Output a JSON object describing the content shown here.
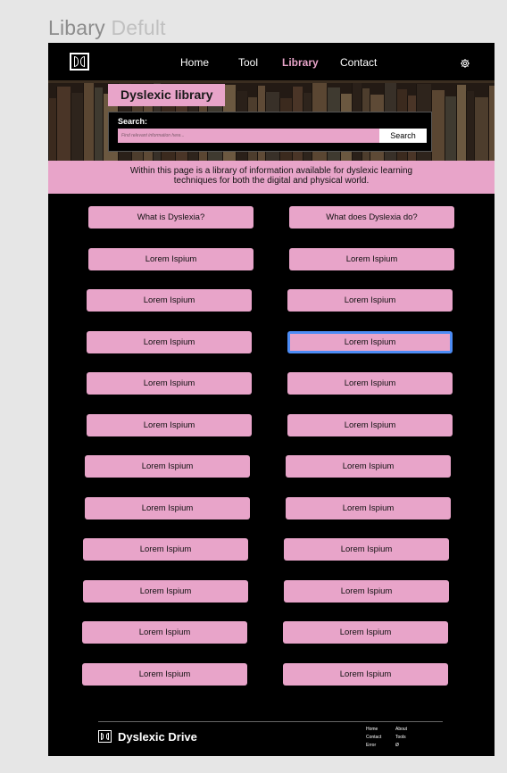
{
  "frame": {
    "title": "Libary",
    "subtitle": "Defult"
  },
  "nav": {
    "links": [
      {
        "label": "Home",
        "active": false
      },
      {
        "label": "Tool",
        "active": false
      },
      {
        "label": "Library",
        "active": true
      },
      {
        "label": "Contact",
        "active": false
      }
    ],
    "settings_icon": "gear-icon",
    "logo_icon": "dyslexic-drive-logo-icon"
  },
  "hero": {
    "title": "Dyslexic library",
    "search": {
      "label": "Search:",
      "placeholder": "Find relevant information here...",
      "button_label": "Search"
    }
  },
  "info": {
    "text": "Within this page is a library of information available for dyslexic learning techniques for both the digital and physical world."
  },
  "topics": [
    [
      "What is Dyslexia?",
      "What does Dyslexia do?"
    ],
    [
      "Lorem Ispium",
      "Lorem Ispium"
    ],
    [
      "Lorem Ispium",
      "Lorem Ispium"
    ],
    [
      "Lorem Ispium",
      "Lorem Ispium"
    ],
    [
      "Lorem Ispium",
      "Lorem Ispium"
    ],
    [
      "Lorem Ispium",
      "Lorem Ispium"
    ],
    [
      "Lorem Ispium",
      "Lorem Ispium"
    ],
    [
      "Lorem Ispium",
      "Lorem Ispium"
    ],
    [
      "Lorem Ispium",
      "Lorem Ispium"
    ],
    [
      "Lorem Ispium",
      "Lorem Ispium"
    ],
    [
      "Lorem Ispium",
      "Lorem Ispium"
    ],
    [
      "Lorem Ispium",
      "Lorem Ispium"
    ]
  ],
  "selected_topic": {
    "row": 3,
    "col": 1
  },
  "footer": {
    "brand": "Dyslexic Drive",
    "col1": [
      "Home",
      "Contact",
      "Error"
    ],
    "col2": [
      "About",
      "Tools",
      "Ø"
    ]
  },
  "colors": {
    "accent_pink": "#e8a4c9",
    "background": "#000000",
    "selection_blue": "#4d8cf5",
    "active_link": "#e8a4c9"
  }
}
